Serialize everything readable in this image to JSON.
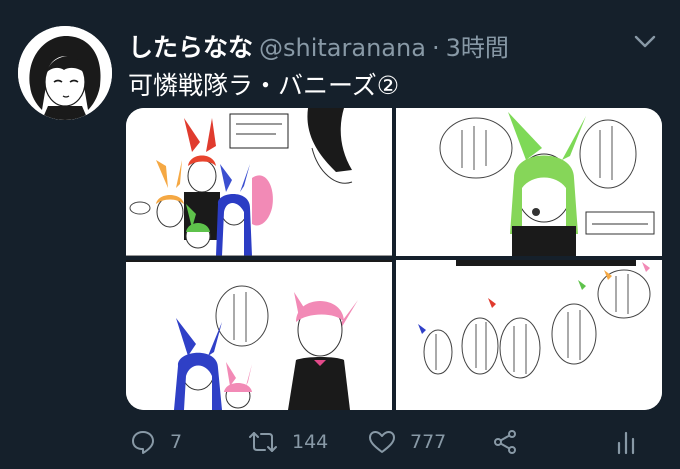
{
  "tweet": {
    "display_name": "したらなな",
    "handle": "@shitaranana",
    "separator": "·",
    "time": "3時間",
    "text": "可憐戦隊ラ・バニーズ②"
  },
  "actions": {
    "reply_count": "7",
    "retweet_count": "144",
    "like_count": "777"
  },
  "colors": {
    "background": "#15202b",
    "secondary_text": "#8899a6",
    "primary_text": "#ffffff"
  },
  "icons": {
    "reply": "reply-icon",
    "retweet": "retweet-icon",
    "like": "heart-icon",
    "share": "share-icon",
    "analytics": "analytics-icon",
    "menu": "chevron-down-icon"
  }
}
